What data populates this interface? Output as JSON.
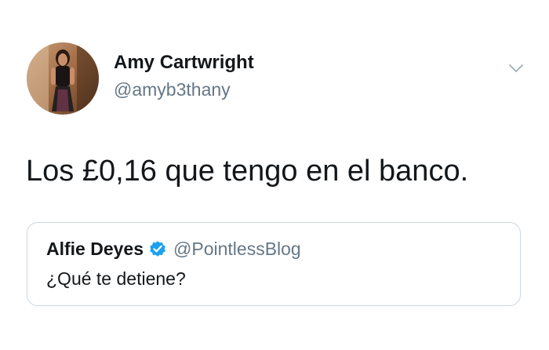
{
  "tweet": {
    "author": {
      "display_name": "Amy Cartwright",
      "handle": "@amyb3thany"
    },
    "text": "Los £0,16 que tengo en el banco.",
    "menu_icon": "chevron-down-icon"
  },
  "quoted_tweet": {
    "author": {
      "display_name": "Alfie Deyes",
      "handle": "@PointlessBlog",
      "verified": true
    },
    "text": "¿Qué te detiene?"
  },
  "colors": {
    "text_primary": "#14171a",
    "text_secondary": "#657786",
    "verified_blue": "#1da1f2",
    "border": "#ccd6dd"
  }
}
